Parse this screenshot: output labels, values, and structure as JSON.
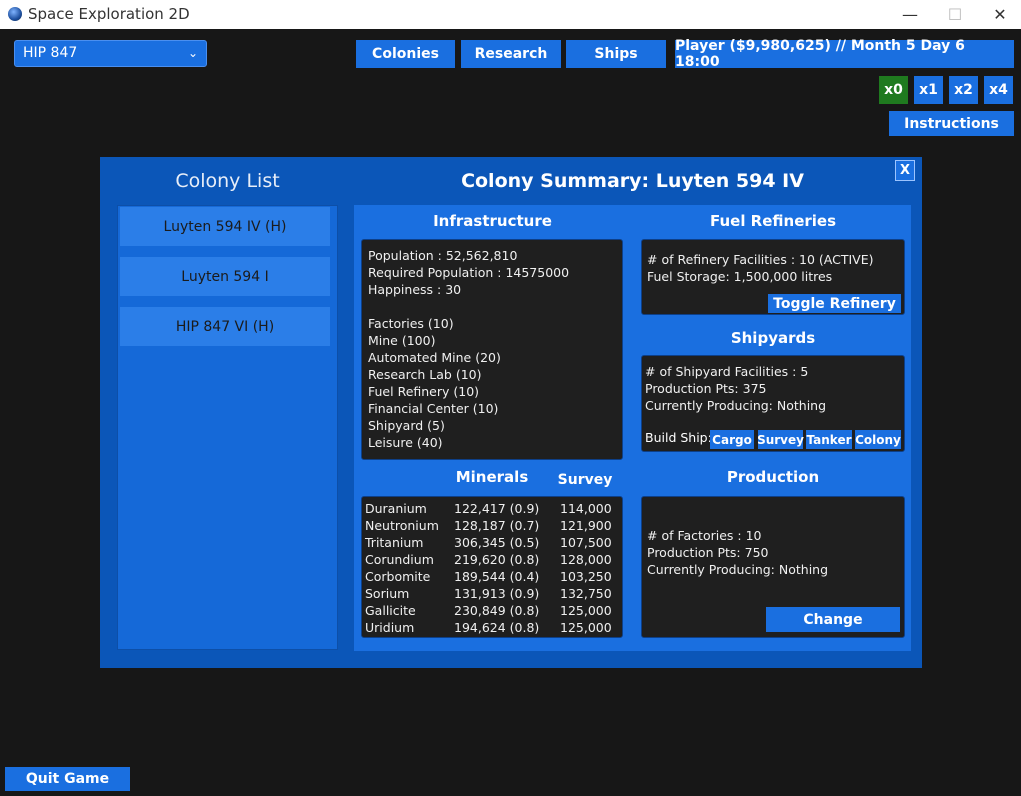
{
  "window": {
    "title": "Space Exploration 2D",
    "minimize": "—",
    "maximize": "☐",
    "close": "✕"
  },
  "top": {
    "system_select": {
      "value": "HIP 847"
    },
    "nav": {
      "colonies": "Colonies",
      "research": "Research",
      "ships": "Ships"
    },
    "player_status": "Player ($9,980,625) // Month 5 Day 6 18:00",
    "speed": [
      "x0",
      "x1",
      "x2",
      "x4"
    ],
    "instructions": "Instructions"
  },
  "modal": {
    "close": "X",
    "colony_list_title": "Colony List",
    "colonies": [
      "Luyten 594 IV (H)",
      "Luyten 594 I",
      "HIP 847 VI (H)"
    ],
    "summary_title": "Colony Summary: Luyten 594 IV",
    "infrastructure": {
      "title": "Infrastructure",
      "stats": [
        "Population : 52,562,810",
        "Required Population : 14575000",
        "Happiness : 30"
      ],
      "buildings": [
        "Factories (10)",
        "Mine (100)",
        "Automated Mine (20)",
        "Research Lab (10)",
        "Fuel Refinery (10)",
        "Financial Center (10)",
        "Shipyard (5)",
        "Leisure (40)"
      ]
    },
    "minerals": {
      "title": "Minerals",
      "survey_title": "Survey",
      "rows": [
        [
          "Duranium",
          "122,417 (0.9)",
          "114,000"
        ],
        [
          "Neutronium",
          "128,187 (0.7)",
          "121,900"
        ],
        [
          "Tritanium",
          "306,345 (0.5)",
          "107,500"
        ],
        [
          "Corundium",
          "219,620 (0.8)",
          "128,000"
        ],
        [
          "Corbomite",
          "189,544 (0.4)",
          "103,250"
        ],
        [
          "Sorium",
          "131,913 (0.9)",
          "132,750"
        ],
        [
          "Gallicite",
          "230,849 (0.8)",
          "125,000"
        ],
        [
          "Uridium",
          "194,624 (0.8)",
          "125,000"
        ]
      ]
    },
    "fuel": {
      "title": "Fuel Refineries",
      "lines": [
        "# of Refinery Facilities : 10 (ACTIVE)",
        "Fuel Storage: 1,500,000 litres"
      ],
      "toggle": "Toggle Refinery"
    },
    "shipyards": {
      "title": "Shipyards",
      "lines": [
        "# of Shipyard Facilities : 5",
        "Production Pts: 375",
        "Currently Producing: Nothing"
      ],
      "build_label": "Build Ship:",
      "build_buttons": [
        "Cargo",
        "Survey",
        "Tanker",
        "Colony"
      ]
    },
    "production": {
      "title": "Production",
      "lines": [
        "# of Factories : 10",
        "Production Pts: 750",
        "Currently Producing: Nothing"
      ],
      "change": "Change"
    }
  },
  "quit": "Quit Game",
  "colors": {
    "accent": "#1a6fe0",
    "modal_bg": "#0b56b8",
    "speed_active": "#1f7a1f",
    "background": "#171717"
  }
}
